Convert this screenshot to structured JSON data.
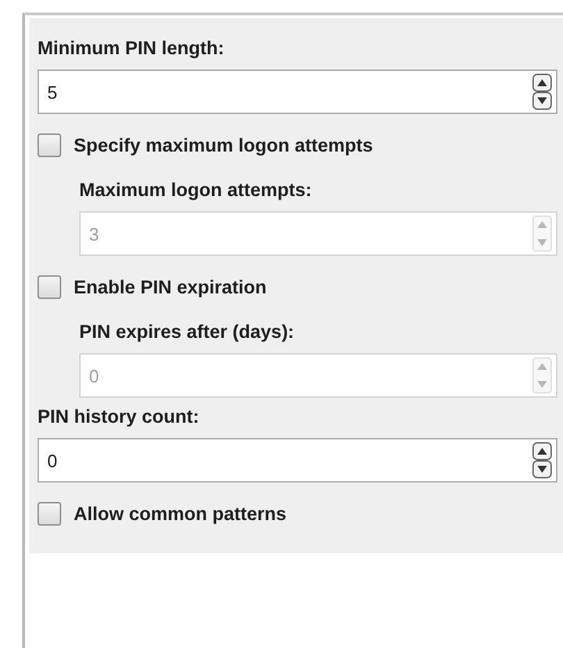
{
  "settings": [
    {
      "kind": "spin",
      "label": "Minimum PIN length:",
      "value": "5",
      "disabled": false
    },
    {
      "kind": "check",
      "label": "Specify maximum logon attempts",
      "checked": false,
      "children": [
        {
          "kind": "spin",
          "label": "Maximum logon attempts:",
          "value": "3",
          "disabled": true
        }
      ]
    },
    {
      "kind": "check",
      "label": "Enable PIN expiration",
      "checked": false,
      "children": [
        {
          "kind": "spin",
          "label": "PIN expires after (days):",
          "value": "0",
          "disabled": true
        }
      ]
    },
    {
      "kind": "spin",
      "label": "PIN history count:",
      "value": "0",
      "disabled": false
    },
    {
      "kind": "check",
      "label": "Allow common patterns",
      "checked": false
    }
  ]
}
